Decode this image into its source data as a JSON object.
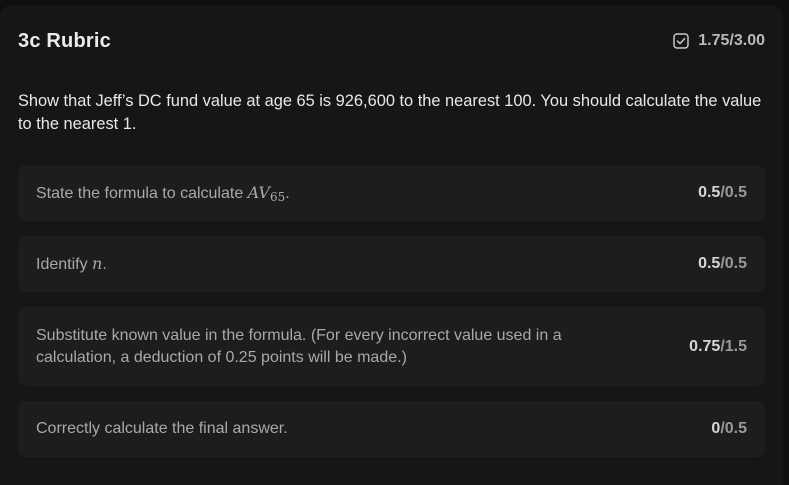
{
  "header": {
    "title": "3c Rubric",
    "score_earned": "1.75",
    "score_total": "/3.00",
    "check_icon": "checkbox-check-icon"
  },
  "question": "Show that Jeff’s DC fund value at age 65 is 926,600 to the nearest 100. You should calculate the value to the nearest 1.",
  "criteria": [
    {
      "text_before": "State the formula to calculate ",
      "math_main": "AV",
      "math_sub": "65",
      "text_after": ".",
      "earned": "0.5",
      "possible": "/0.5"
    },
    {
      "text_before": "Identify ",
      "math_main": "n",
      "text_after": ".",
      "earned": "0.5",
      "possible": "/0.5"
    },
    {
      "text": "Substitute known value in the formula. (For every incorrect value used in a calculation, a deduction of 0.25 points will be made.)",
      "earned": "0.75",
      "possible": "/1.5"
    },
    {
      "text": "Correctly calculate the final answer.",
      "earned": "0",
      "possible": "/0.5"
    }
  ],
  "colors": {
    "background": "#0f0f0f",
    "panel": "#161616",
    "card": "#1d1d1d",
    "text_primary": "#e8e8e8",
    "text_secondary": "#a9a9a9"
  }
}
